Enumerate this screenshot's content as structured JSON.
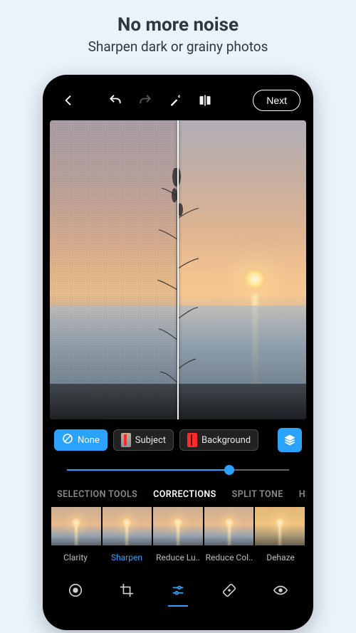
{
  "promo": {
    "title": "No more noise",
    "subtitle": "Sharpen dark or grainy photos"
  },
  "toolbar": {
    "next_label": "Next"
  },
  "masks": {
    "none": "None",
    "subject": "Subject",
    "background": "Background"
  },
  "slider": {
    "value_percent": 73
  },
  "tabs": {
    "items": [
      "SELECTION TOOLS",
      "CORRECTIONS",
      "SPLIT TONE",
      "HSL"
    ],
    "active_index": 1
  },
  "corrections": {
    "items": [
      {
        "label": "Clarity"
      },
      {
        "label": "Sharpen",
        "selected": true
      },
      {
        "label": "Reduce Lu.."
      },
      {
        "label": "Reduce Col.."
      },
      {
        "label": "Dehaze"
      }
    ]
  },
  "bottom_nav": {
    "items": [
      "looks",
      "crop",
      "adjust",
      "heal",
      "redeye"
    ],
    "active_index": 2
  }
}
